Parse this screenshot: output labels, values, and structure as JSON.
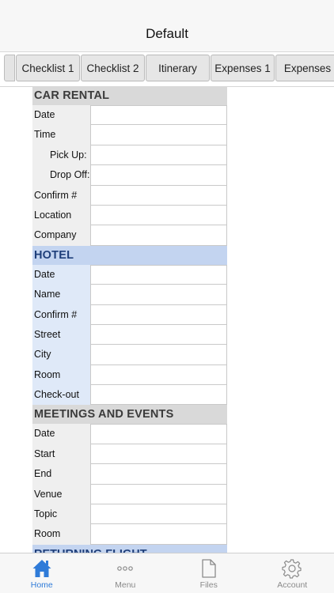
{
  "header": {
    "title": "Default"
  },
  "tabs": [
    {
      "label": "Checklist 1"
    },
    {
      "label": "Checklist 2"
    },
    {
      "label": "Itinerary"
    },
    {
      "label": "Expenses 1"
    },
    {
      "label": "Expenses"
    }
  ],
  "sections": {
    "car_rental": {
      "title": "CAR RENTAL",
      "fields": [
        "Date",
        "Time",
        "Pick Up:",
        "Drop Off:",
        "Confirm #",
        "Location",
        "Company"
      ]
    },
    "hotel": {
      "title": "HOTEL",
      "fields": [
        "Date",
        "Name",
        "Confirm #",
        "Street",
        "City",
        "Room",
        "Check-out"
      ]
    },
    "meetings": {
      "title": "MEETINGS AND EVENTS",
      "fields": [
        "Date",
        "Start",
        "End",
        "Venue",
        "Topic",
        "Room"
      ]
    },
    "returning_flight": {
      "title": "RETURNING FLIGHT"
    }
  },
  "tabbar": [
    {
      "label": "Home",
      "icon": "home-icon"
    },
    {
      "label": "Menu",
      "icon": "more-dots-icon"
    },
    {
      "label": "Files",
      "icon": "document-icon"
    },
    {
      "label": "Account",
      "icon": "gear-icon"
    }
  ],
  "colors": {
    "accent": "#2f7bd8",
    "section_gray": "#d9d9d9",
    "section_blue": "#c3d4f0"
  }
}
